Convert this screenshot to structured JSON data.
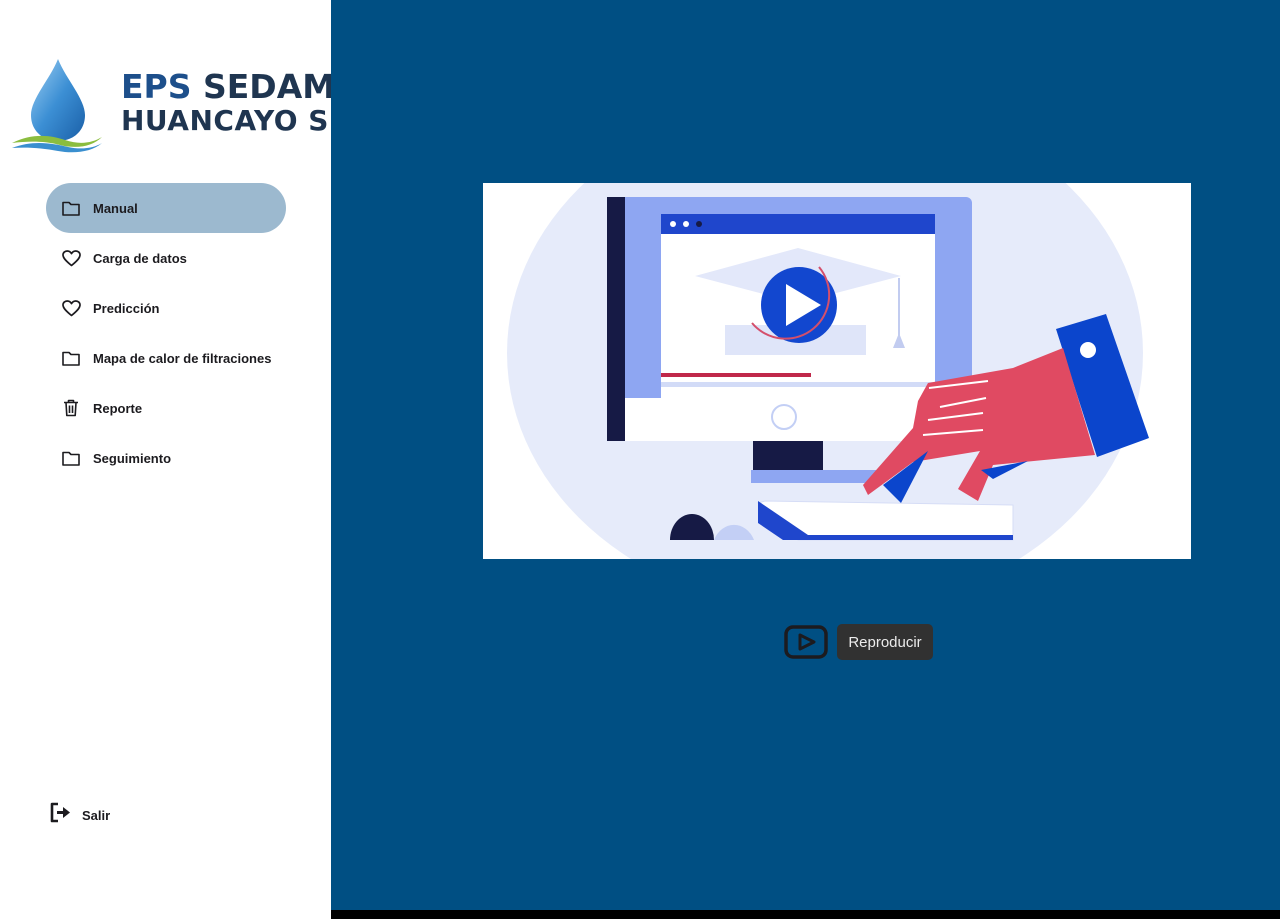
{
  "brand": {
    "line1_eps": "EPS",
    "line1_name": "SEDAM",
    "line2": "HUANCAYO S.A.",
    "colors": {
      "eps": "#1d4f8b",
      "name": "#1f3550",
      "drop": "#2e79c2",
      "wave_green": "#8bbd3f"
    }
  },
  "sidebar": {
    "items": [
      {
        "label": "Manual",
        "icon": "folder-icon",
        "active": true
      },
      {
        "label": "Carga de datos",
        "icon": "heart-icon",
        "active": false
      },
      {
        "label": "Predicción",
        "icon": "heart-icon",
        "active": false
      },
      {
        "label": "Mapa de calor de filtraciones",
        "icon": "folder-icon",
        "active": false
      },
      {
        "label": "Reporte",
        "icon": "trash-icon",
        "active": false
      },
      {
        "label": "Seguimiento",
        "icon": "folder-icon",
        "active": false
      }
    ],
    "exit_label": "Salir"
  },
  "main": {
    "play_icon": "youtube-play-icon",
    "tooltip": "Reproducir",
    "colors": {
      "background": "#004f83",
      "active_nav": "#9cb9cf"
    }
  }
}
